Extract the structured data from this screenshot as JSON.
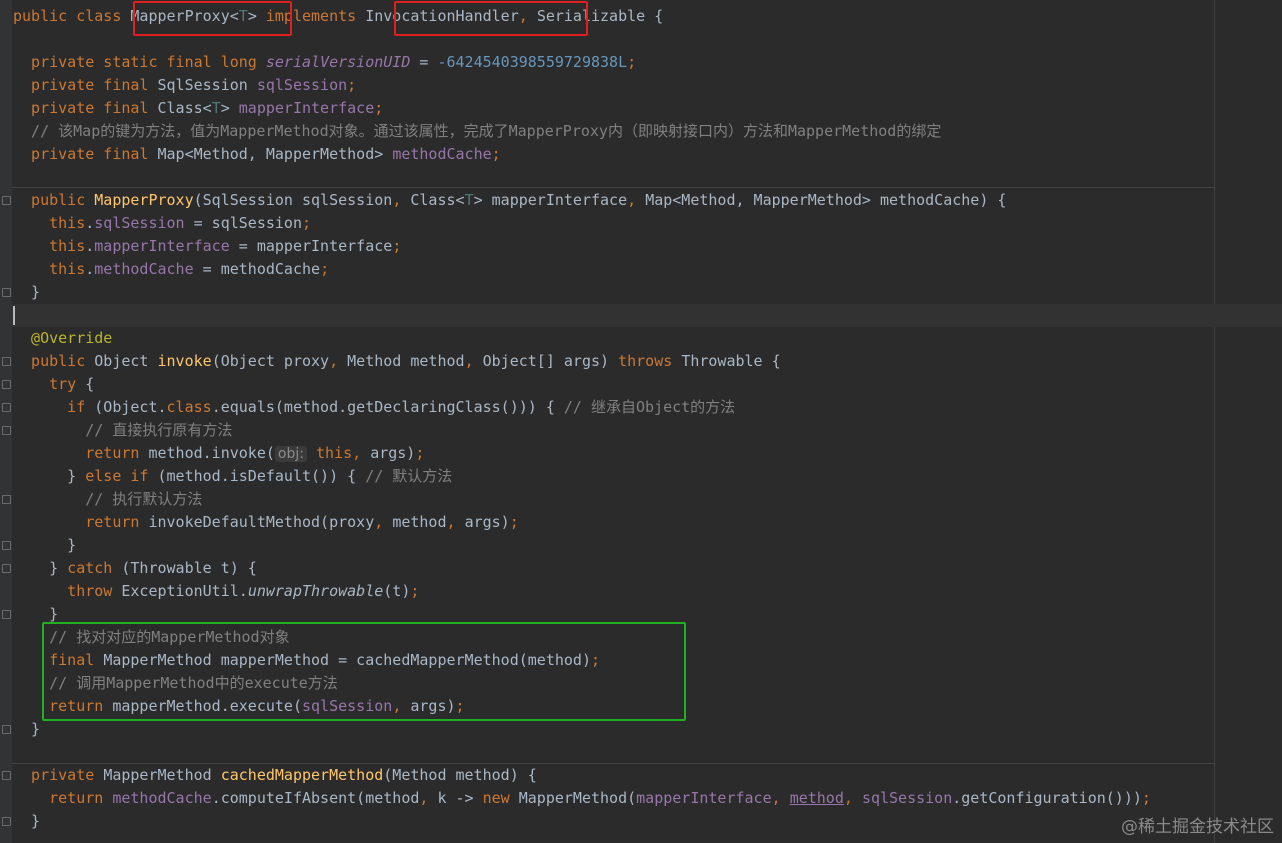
{
  "editor": {
    "lines": [
      [
        {
          "t": "public class ",
          "c": "k"
        },
        {
          "t": "MapperProxy<",
          "c": ""
        },
        {
          "t": "T",
          "c": "tp"
        },
        {
          "t": "> ",
          "c": ""
        },
        {
          "t": "implements ",
          "c": "k"
        },
        {
          "t": "InvocationHandler",
          "c": ""
        },
        {
          "t": ", ",
          "c": "k"
        },
        {
          "t": "Serializable {",
          "c": ""
        }
      ],
      [],
      [
        {
          "t": "  private static final long ",
          "c": "k"
        },
        {
          "t": "serialVersionUID",
          "c": "vi"
        },
        {
          "t": " = ",
          "c": ""
        },
        {
          "t": "-6424540398559729838L",
          "c": "n"
        },
        {
          "t": ";",
          "c": "k"
        }
      ],
      [
        {
          "t": "  private final ",
          "c": "k"
        },
        {
          "t": "SqlSession ",
          "c": ""
        },
        {
          "t": "sqlSession",
          "c": "v"
        },
        {
          "t": ";",
          "c": "k"
        }
      ],
      [
        {
          "t": "  private final ",
          "c": "k"
        },
        {
          "t": "Class<",
          "c": ""
        },
        {
          "t": "T",
          "c": "tp"
        },
        {
          "t": "> ",
          "c": ""
        },
        {
          "t": "mapperInterface",
          "c": "v"
        },
        {
          "t": ";",
          "c": "k"
        }
      ],
      [
        {
          "t": "  // 该Map的键为方法，值为MapperMethod对象。通过该属性，完成了MapperProxy内（即映射接口内）方法和MapperMethod的绑定",
          "c": "c"
        }
      ],
      [
        {
          "t": "  private final ",
          "c": "k"
        },
        {
          "t": "Map<Method, MapperMethod> ",
          "c": ""
        },
        {
          "t": "methodCache",
          "c": "v"
        },
        {
          "t": ";",
          "c": "k"
        }
      ],
      [],
      [
        {
          "t": "  public ",
          "c": "k"
        },
        {
          "t": "MapperProxy",
          "c": "f"
        },
        {
          "t": "(SqlSession sqlSession",
          "c": ""
        },
        {
          "t": ", ",
          "c": "k"
        },
        {
          "t": "Class<",
          "c": ""
        },
        {
          "t": "T",
          "c": "tp"
        },
        {
          "t": "> mapperInterface",
          "c": ""
        },
        {
          "t": ", ",
          "c": "k"
        },
        {
          "t": "Map<Method, MapperMethod> methodCache) {",
          "c": ""
        }
      ],
      [
        {
          "t": "    this",
          "c": "k"
        },
        {
          "t": ".",
          "c": ""
        },
        {
          "t": "sqlSession",
          "c": "v"
        },
        {
          "t": " = sqlSession",
          "c": ""
        },
        {
          "t": ";",
          "c": "k"
        }
      ],
      [
        {
          "t": "    this",
          "c": "k"
        },
        {
          "t": ".",
          "c": ""
        },
        {
          "t": "mapperInterface",
          "c": "v"
        },
        {
          "t": " = mapperInterface",
          "c": ""
        },
        {
          "t": ";",
          "c": "k"
        }
      ],
      [
        {
          "t": "    this",
          "c": "k"
        },
        {
          "t": ".",
          "c": ""
        },
        {
          "t": "methodCache",
          "c": "v"
        },
        {
          "t": " = methodCache",
          "c": ""
        },
        {
          "t": ";",
          "c": "k"
        }
      ],
      [
        {
          "t": "  }",
          "c": ""
        }
      ],
      [],
      [
        {
          "t": "  @Override",
          "c": "a"
        }
      ],
      [
        {
          "t": "  public ",
          "c": "k"
        },
        {
          "t": "Object ",
          "c": ""
        },
        {
          "t": "invoke",
          "c": "f"
        },
        {
          "t": "(Object proxy",
          "c": ""
        },
        {
          "t": ", ",
          "c": "k"
        },
        {
          "t": "Method method",
          "c": ""
        },
        {
          "t": ", ",
          "c": "k"
        },
        {
          "t": "Object[] args) ",
          "c": ""
        },
        {
          "t": "throws ",
          "c": "k"
        },
        {
          "t": "Throwable {",
          "c": ""
        }
      ],
      [
        {
          "t": "    try ",
          "c": "k"
        },
        {
          "t": "{",
          "c": ""
        }
      ],
      [
        {
          "t": "      if ",
          "c": "k"
        },
        {
          "t": "(Object.",
          "c": ""
        },
        {
          "t": "class",
          "c": "k"
        },
        {
          "t": ".equals(method.getDeclaringClass())) { ",
          "c": ""
        },
        {
          "t": "// 继承自Object的方法",
          "c": "c"
        }
      ],
      [
        {
          "t": "        // 直接执行原有方法",
          "c": "c"
        }
      ],
      [
        {
          "t": "        return ",
          "c": "k"
        },
        {
          "t": "method.invoke(",
          "c": ""
        },
        {
          "t": "obj:",
          "c": "hint"
        },
        {
          "t": " this",
          "c": "k"
        },
        {
          "t": ", ",
          "c": "k"
        },
        {
          "t": "args)",
          "c": ""
        },
        {
          "t": ";",
          "c": "k"
        }
      ],
      [
        {
          "t": "      } ",
          "c": ""
        },
        {
          "t": "else if ",
          "c": "k"
        },
        {
          "t": "(method.isDefault()) { ",
          "c": ""
        },
        {
          "t": "// 默认方法",
          "c": "c"
        }
      ],
      [
        {
          "t": "        // 执行默认方法",
          "c": "c"
        }
      ],
      [
        {
          "t": "        return ",
          "c": "k"
        },
        {
          "t": "invokeDefaultMethod(proxy",
          "c": ""
        },
        {
          "t": ", ",
          "c": "k"
        },
        {
          "t": "method",
          "c": ""
        },
        {
          "t": ", ",
          "c": "k"
        },
        {
          "t": "args)",
          "c": ""
        },
        {
          "t": ";",
          "c": "k"
        }
      ],
      [
        {
          "t": "      }",
          "c": ""
        }
      ],
      [
        {
          "t": "    } ",
          "c": ""
        },
        {
          "t": "catch ",
          "c": "k"
        },
        {
          "t": "(Throwable t) {",
          "c": ""
        }
      ],
      [
        {
          "t": "      throw ",
          "c": "k"
        },
        {
          "t": "ExceptionUtil.",
          "c": ""
        },
        {
          "t": "unwrapThrowable",
          "c": "it"
        },
        {
          "t": "(t)",
          "c": ""
        },
        {
          "t": ";",
          "c": "k"
        }
      ],
      [
        {
          "t": "    }",
          "c": ""
        }
      ],
      [
        {
          "t": "    // 找对对应的MapperMethod对象",
          "c": "c"
        }
      ],
      [
        {
          "t": "    final ",
          "c": "k"
        },
        {
          "t": "MapperMethod mapperMethod = cachedMapperMethod(method)",
          "c": ""
        },
        {
          "t": ";",
          "c": "k"
        }
      ],
      [
        {
          "t": "    // 调用MapperMethod中的execute方法",
          "c": "c"
        }
      ],
      [
        {
          "t": "    return ",
          "c": "k"
        },
        {
          "t": "mapperMethod.execute(",
          "c": ""
        },
        {
          "t": "sqlSession",
          "c": "v"
        },
        {
          "t": ", ",
          "c": "k"
        },
        {
          "t": "args)",
          "c": ""
        },
        {
          "t": ";",
          "c": "k"
        }
      ],
      [
        {
          "t": "  }",
          "c": ""
        }
      ],
      [],
      [
        {
          "t": "  private ",
          "c": "k"
        },
        {
          "t": "MapperMethod ",
          "c": ""
        },
        {
          "t": "cachedMapperMethod",
          "c": "f"
        },
        {
          "t": "(Method method) {",
          "c": ""
        }
      ],
      [
        {
          "t": "    return ",
          "c": "k"
        },
        {
          "t": "methodCache",
          "c": "v"
        },
        {
          "t": ".computeIfAbsent(method",
          "c": ""
        },
        {
          "t": ", ",
          "c": "k"
        },
        {
          "t": "k -> ",
          "c": ""
        },
        {
          "t": "new ",
          "c": "k"
        },
        {
          "t": "MapperMethod(",
          "c": ""
        },
        {
          "t": "mapperInterface",
          "c": "v"
        },
        {
          "t": ", ",
          "c": "k"
        },
        {
          "t": "method",
          "c": "v u"
        },
        {
          "t": ", ",
          "c": "k"
        },
        {
          "t": "sqlSession",
          "c": "v"
        },
        {
          "t": ".getConfiguration()))",
          "c": ""
        },
        {
          "t": ";",
          "c": "k"
        }
      ],
      [
        {
          "t": "  }",
          "c": ""
        }
      ]
    ]
  },
  "watermark": "@稀土掘金技术社区"
}
